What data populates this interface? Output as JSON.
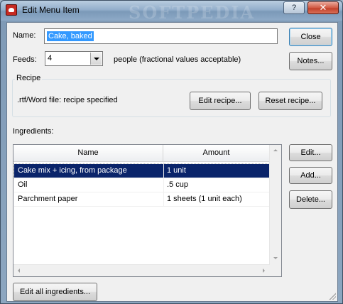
{
  "window": {
    "title": "Edit Menu Item",
    "watermark": "SOFTPEDIA",
    "help_label": "?",
    "close_label": "✕"
  },
  "form": {
    "name_label": "Name:",
    "name_value": "Cake, baked",
    "feeds_label": "Feeds:",
    "feeds_value": "4",
    "feeds_hint": "people (fractional values acceptable)"
  },
  "buttons": {
    "close": "Close",
    "notes": "Notes...",
    "edit_recipe": "Edit recipe...",
    "reset_recipe": "Reset recipe...",
    "edit": "Edit...",
    "add": "Add...",
    "delete": "Delete...",
    "edit_all": "Edit all ingredients..."
  },
  "recipe": {
    "group_title": "Recipe",
    "status": ".rtf/Word file: recipe specified"
  },
  "ingredients": {
    "label": "Ingredients:",
    "columns": [
      "Name",
      "Amount"
    ],
    "rows": [
      {
        "name": "Cake mix + icing, from package",
        "amount": "1 unit",
        "selected": true
      },
      {
        "name": "Oil",
        "amount": ".5 cup",
        "selected": false
      },
      {
        "name": "Parchment paper",
        "amount": "1 sheets (1 unit each)",
        "selected": false
      }
    ]
  },
  "colors": {
    "selection": "#0a246a",
    "text_selection": "#3399ff"
  }
}
